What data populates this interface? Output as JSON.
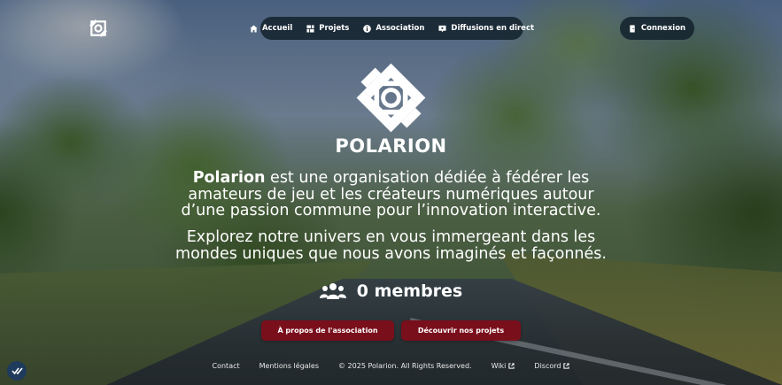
{
  "nav": {
    "items": [
      {
        "label": "Accueil",
        "icon": "home-icon"
      },
      {
        "label": "Projets",
        "icon": "projects-grid-icon"
      },
      {
        "label": "Association",
        "icon": "info-icon"
      },
      {
        "label": "Diffusions en direct",
        "icon": "live-stream-icon"
      }
    ],
    "login_label": "Connexion",
    "login_icon": "door-icon"
  },
  "hero": {
    "brand": "POLARION",
    "intro_brand": "Polarion",
    "intro_rest": " est une organisation dédiée à fédérer les amateurs de jeu et les créateurs numériques autour d’une passion commune pour l’innovation interactive.",
    "explore": "Explorez notre univers en vous immergeant dans les mondes uniques que nous avons imaginés et façonnés.",
    "members_count": "0 membres",
    "members_icon": "users-icon"
  },
  "buttons": {
    "about": "À propos de l'association",
    "projects": "Découvrir nos projets"
  },
  "footer": {
    "contact": "Contact",
    "legal": "Mentions légales",
    "copyright": "© 2025 Polarion. All Rights Reserved.",
    "wiki": "Wiki",
    "discord": "Discord"
  },
  "colors": {
    "nav_bg": "#14232d",
    "button_red": "#7a0f1c",
    "badge_blue": "#1e3a5c"
  }
}
